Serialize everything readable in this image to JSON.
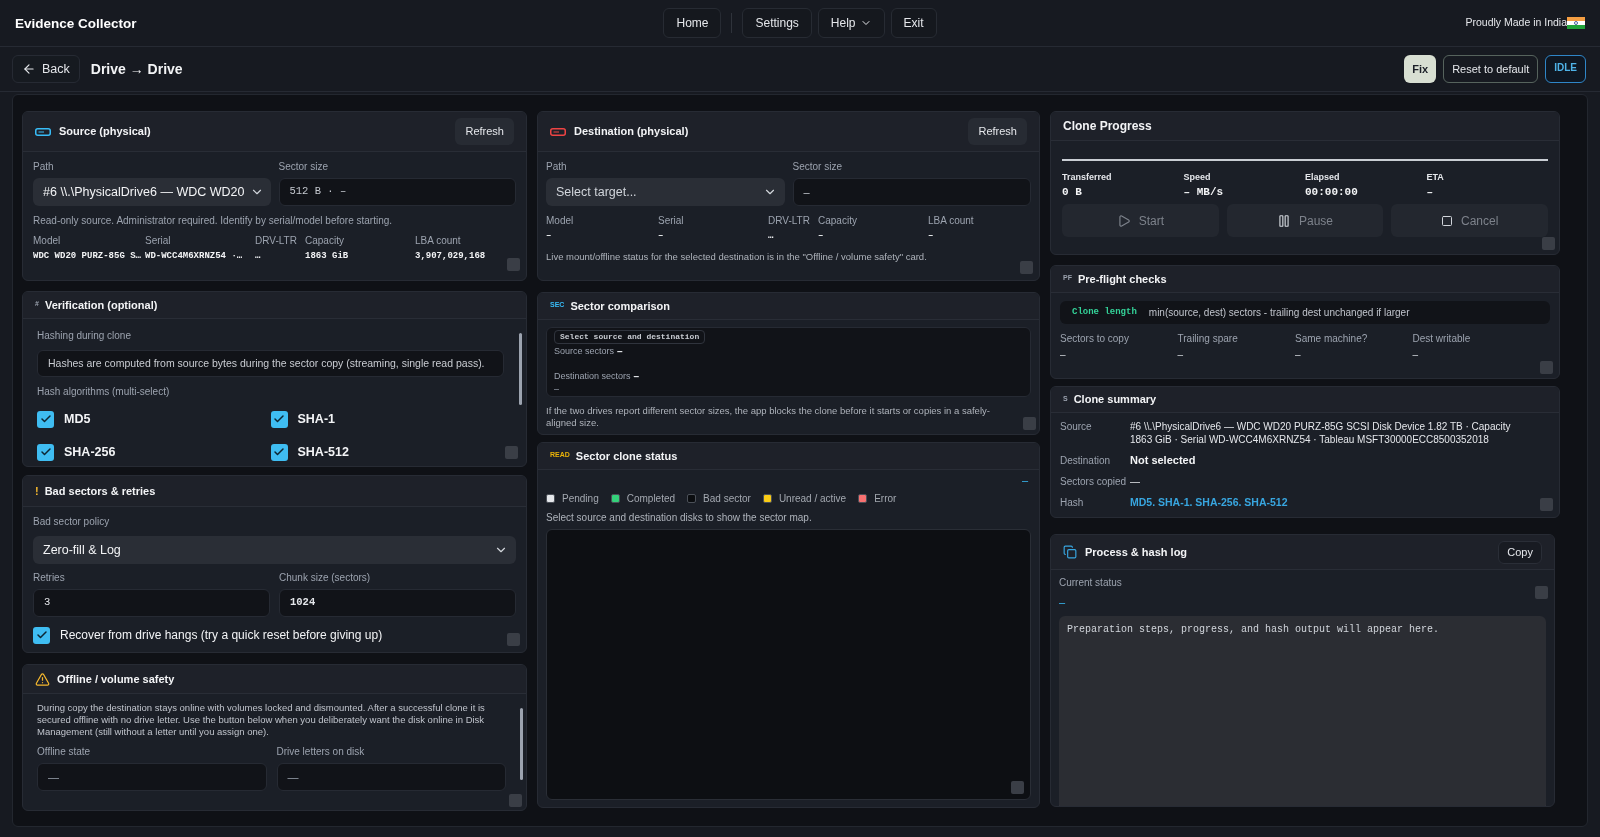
{
  "header": {
    "title": "Evidence Collector",
    "nav": [
      {
        "label": "Home",
        "kind": "link"
      },
      {
        "label": "Settings",
        "kind": "link"
      },
      {
        "label": "Help",
        "kind": "menu"
      },
      {
        "label": "Exit",
        "kind": "link"
      }
    ],
    "tagline": "Proudly Made in India"
  },
  "toolbar": {
    "back": "Back",
    "title": "Drive → Drive",
    "actions": [
      {
        "label": "Fix",
        "kind": "primary"
      },
      {
        "label": "Reset to default",
        "kind": "outline"
      }
    ],
    "status": "IDLE"
  },
  "source": {
    "title": "Source (physical)",
    "refresh": "Refresh",
    "path_label": "Path",
    "path_value": "#6 \\\\.\\PhysicalDrive6 — WDC WD20",
    "sector_size_label": "Sector size",
    "sector_size_value": "512 B · –",
    "note": "Read-only source. Administrator required. Identify by serial/model before starting.",
    "fields": [
      {
        "label": "Model",
        "value": "WDC WD20 PURZ-85G S…"
      },
      {
        "label": "Serial",
        "value": "WD-WCC4M6XRNZ54 ·…"
      },
      {
        "label": "DRV-LTR",
        "value": "…"
      },
      {
        "label": "Capacity",
        "value": "1863 GiB"
      },
      {
        "label": "LBA count",
        "value": "3,907,029,168"
      }
    ]
  },
  "verification": {
    "tag": "#",
    "title": "Verification (optional)",
    "hashing_label": "Hashing during clone",
    "hashing_info": "Hashes are computed from source bytes during the sector copy (streaming, single read pass).",
    "algorithms_label": "Hash algorithms (multi-select)",
    "algorithms": [
      {
        "label": "MD5",
        "checked": true
      },
      {
        "label": "SHA-1",
        "checked": true
      },
      {
        "label": "SHA-256",
        "checked": true
      },
      {
        "label": "SHA-512",
        "checked": true
      }
    ]
  },
  "bad_sectors": {
    "tag": "!",
    "title": "Bad sectors & retries",
    "policy_label": "Bad sector policy",
    "policy_value": "Zero-fill & Log",
    "retries_label": "Retries",
    "retries_value": "3",
    "chunk_label": "Chunk size (sectors)",
    "chunk_value": "1024",
    "recover": {
      "label": "Recover from drive hangs (try a quick reset before giving up)",
      "checked": true
    }
  },
  "offline": {
    "title": "Offline / volume safety",
    "description": "During copy the destination stays online with volumes locked and dismounted. After a successful clone it is secured offline with no drive letter. Use the button below when you deliberately want the disk online in Disk Management (still without a letter until you assign one).",
    "state_label": "Offline state",
    "state_value": "—",
    "letters_label": "Drive letters on disk",
    "letters_value": "—"
  },
  "destination": {
    "title": "Destination (physical)",
    "refresh": "Refresh",
    "path_label": "Path",
    "path_placeholder": "Select target...",
    "sector_size_label": "Sector size",
    "sector_size_value": "–",
    "fields": [
      {
        "label": "Model",
        "value": "–"
      },
      {
        "label": "Serial",
        "value": "–"
      },
      {
        "label": "DRV-LTR",
        "value": "…"
      },
      {
        "label": "Capacity",
        "value": "–"
      },
      {
        "label": "LBA count",
        "value": "–"
      }
    ],
    "note": "Live mount/offline status for the selected destination is in the \"Offline / volume safety\" card."
  },
  "sector_comparison": {
    "tag": "SEC",
    "title": "Sector comparison",
    "status": "Select source and destination",
    "rows": [
      {
        "label": "Source sectors",
        "value": "–"
      },
      {
        "label": "Destination sectors",
        "value": "–"
      }
    ],
    "result": "–",
    "note": "If the two drives report different sector sizes, the app blocks the clone before it starts or copies in a safely-aligned size."
  },
  "sector_status": {
    "tag": "READ",
    "title": "Sector clone status",
    "progress_text": "–",
    "legend": [
      {
        "label": "Pending",
        "color": "#e5e7eb"
      },
      {
        "label": "Completed",
        "color": "#34d17a"
      },
      {
        "label": "Bad sector",
        "color": "#0b0d10"
      },
      {
        "label": "Unread / active",
        "color": "#facc15"
      },
      {
        "label": "Error",
        "color": "#f87171"
      }
    ],
    "hint": "Select source and destination disks to show the sector map."
  },
  "clone_progress": {
    "title": "Clone Progress",
    "stats": [
      {
        "label": "Transferred",
        "value": "0 B"
      },
      {
        "label": "Speed",
        "value": "– MB/s"
      },
      {
        "label": "Elapsed",
        "value": "00:00:00"
      },
      {
        "label": "ETA",
        "value": "–"
      }
    ],
    "buttons": [
      {
        "label": "Start",
        "kind": "start",
        "disabled": true
      },
      {
        "label": "Pause",
        "kind": "pause",
        "disabled": true
      },
      {
        "label": "Cancel",
        "kind": "cancel",
        "disabled": true
      }
    ]
  },
  "preflight": {
    "tag": "PF",
    "title": "Pre-flight checks",
    "rule_name": "Clone length",
    "rule_text": "min(source, dest) sectors - trailing dest unchanged if larger",
    "checks": [
      {
        "label": "Sectors to copy",
        "value": "–"
      },
      {
        "label": "Trailing spare",
        "value": "–"
      },
      {
        "label": "Same machine?",
        "value": "–"
      },
      {
        "label": "Dest writable",
        "value": "–"
      }
    ]
  },
  "summary": {
    "tag": "S",
    "title": "Clone summary",
    "rows": [
      {
        "label": "Source",
        "value": "#6 \\\\.\\PhysicalDrive6 — WDC WD20 PURZ-85G SCSI Disk Device 1.82 TB · Capacity 1863 GiB · Serial WD-WCC4M6XRNZ54 · Tableau MSFT30000ECC8500352018",
        "kind": "text"
      },
      {
        "label": "Destination",
        "value": "Not selected",
        "kind": "strong"
      },
      {
        "label": "Sectors copied",
        "value": "—",
        "kind": "text"
      },
      {
        "label": "Hash",
        "value": "MD5. SHA-1. SHA-256. SHA-512",
        "kind": "accent"
      }
    ]
  },
  "log": {
    "title": "Process & hash log",
    "copy": "Copy",
    "status_label": "Current status",
    "status_value": "–",
    "placeholder": "Preparation steps, progress, and hash output will appear here."
  }
}
